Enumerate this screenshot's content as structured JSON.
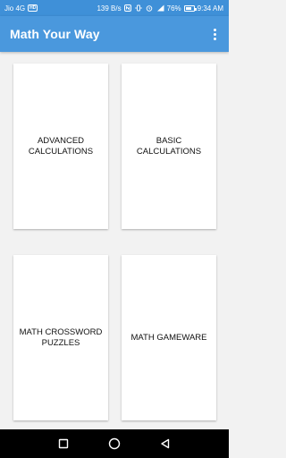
{
  "status_bar": {
    "carrier": "Jio 4G",
    "volte": "HD",
    "speed": "139 B/s",
    "network": "4G",
    "battery_percent": "76%",
    "battery_level": 0.76,
    "time": "9:34 AM"
  },
  "app_bar": {
    "title": "Math Your Way",
    "menu_icon": "more-vert-icon"
  },
  "cards": {
    "advanced": "ADVANCED\nCALCULATIONS",
    "basic": "BASIC\nCALCULATIONS",
    "crossword": "MATH CROSSWORD\nPUZZLES",
    "gameware": "MATH GAMEWARE"
  },
  "nav": {
    "recents_icon": "square-icon",
    "home_icon": "circle-icon",
    "back_icon": "triangle-back-icon"
  },
  "colors": {
    "app_bar": "#4a98dd",
    "status_bar": "#3f90d8",
    "background": "#f2f2f2",
    "card": "#ffffff",
    "nav_bar": "#000000"
  }
}
